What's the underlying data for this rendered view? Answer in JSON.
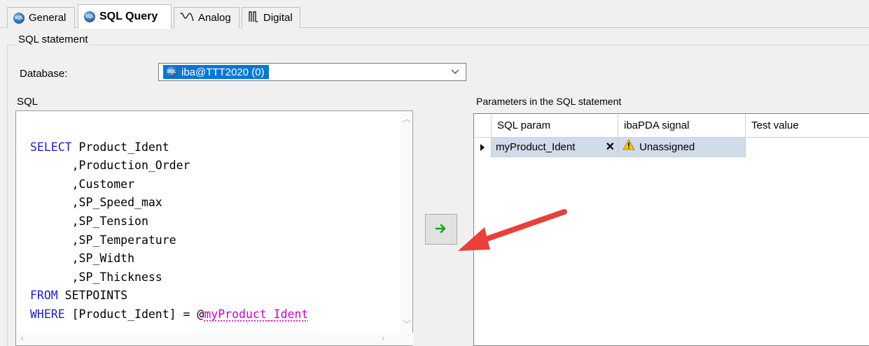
{
  "tabs": [
    {
      "label": "General",
      "icon": "database-icon",
      "active": false
    },
    {
      "label": "SQL Query",
      "icon": "database-icon",
      "active": true
    },
    {
      "label": "Analog",
      "icon": "analog-wave-icon",
      "active": false
    },
    {
      "label": "Digital",
      "icon": "digital-signal-icon",
      "active": false
    }
  ],
  "icons": {
    "db_icon_text": "SQL"
  },
  "group": {
    "title": "SQL statement"
  },
  "database": {
    "label": "Database:",
    "value": "iba@TTT2020 (0)"
  },
  "sql": {
    "label": "SQL",
    "lines": [
      {
        "kw": "SELECT",
        "rest": " Product_Ident"
      },
      {
        "kw": "",
        "rest": "      ,Production_Order"
      },
      {
        "kw": "",
        "rest": "      ,Customer"
      },
      {
        "kw": "",
        "rest": "      ,SP_Speed_max"
      },
      {
        "kw": "",
        "rest": "      ,SP_Tension"
      },
      {
        "kw": "",
        "rest": "      ,SP_Temperature"
      },
      {
        "kw": "",
        "rest": "      ,SP_Width"
      },
      {
        "kw": "",
        "rest": "      ,SP_Thickness"
      },
      {
        "kw": "FROM",
        "rest": " SETPOINTS"
      },
      {
        "kw": "WHERE",
        "rest": " [Product_Ident] = @",
        "param": "myProduct_Ident"
      }
    ]
  },
  "params": {
    "label": "Parameters in the SQL statement",
    "columns": [
      "SQL param",
      "ibaPDA signal",
      "Test value"
    ],
    "rows": [
      {
        "sql_param": "myProduct_Ident",
        "signal": "Unassigned",
        "test_value": ""
      }
    ]
  },
  "colors": {
    "keyword": "#2020c8",
    "param": "#c800c8",
    "selection": "#0078d7",
    "annotation_arrow": "#e8403a",
    "transfer_arrow": "#1aa31a"
  }
}
